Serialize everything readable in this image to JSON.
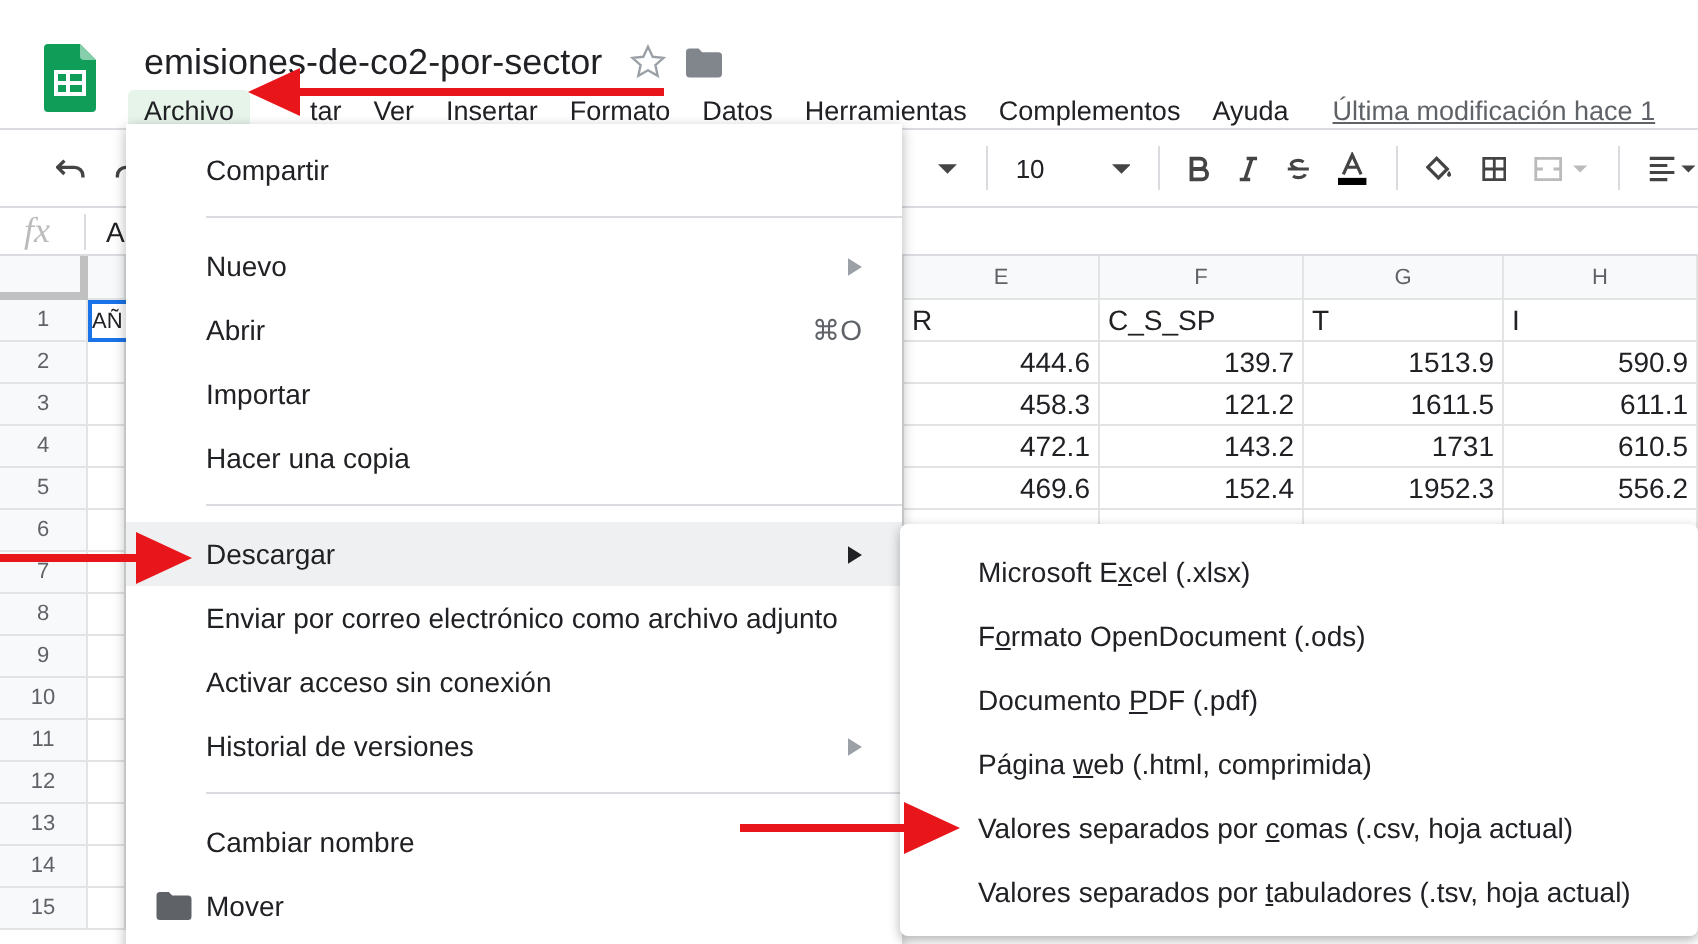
{
  "document": {
    "title": "emisiones-de-co2-por-sector",
    "starred": false
  },
  "menubar": [
    {
      "label": "Archivo",
      "selected": true
    },
    {
      "label": "tar",
      "selected": false
    },
    {
      "label": "Ver",
      "selected": false
    },
    {
      "label": "Insertar",
      "selected": false
    },
    {
      "label": "Formato",
      "selected": false
    },
    {
      "label": "Datos",
      "selected": false
    },
    {
      "label": "Herramientas",
      "selected": false
    },
    {
      "label": "Complementos",
      "selected": false
    },
    {
      "label": "Ayuda",
      "selected": false
    }
  ],
  "last_modified": "Última modificación hace 1",
  "toolbar": {
    "font_size": "10"
  },
  "formula_bar": {
    "label": "fx",
    "value": "A"
  },
  "sheet": {
    "columns": [
      "E",
      "F",
      "G",
      "H"
    ],
    "rows": [
      {
        "number": "1",
        "kind": "text",
        "column_a": "AÑ",
        "cells": [
          "R",
          "C_S_SP",
          "T",
          "I"
        ]
      },
      {
        "number": "2",
        "kind": "number",
        "cells": [
          "444.6",
          "139.7",
          "1513.9",
          "590.9"
        ]
      },
      {
        "number": "3",
        "kind": "number",
        "cells": [
          "458.3",
          "121.2",
          "1611.5",
          "611.1"
        ]
      },
      {
        "number": "4",
        "kind": "number",
        "cells": [
          "472.1",
          "143.2",
          "1731",
          "610.5"
        ]
      },
      {
        "number": "5",
        "kind": "number",
        "cells": [
          "469.6",
          "152.4",
          "1952.3",
          "556.2"
        ]
      },
      {
        "number": "6"
      },
      {
        "number": "7"
      },
      {
        "number": "8"
      },
      {
        "number": "9"
      },
      {
        "number": "10"
      },
      {
        "number": "11"
      },
      {
        "number": "12"
      },
      {
        "number": "13"
      },
      {
        "number": "14"
      },
      {
        "number": "15"
      }
    ]
  },
  "file_menu": [
    {
      "kind": "item",
      "label": "Compartir",
      "selected": false,
      "has_submenu": false
    },
    {
      "kind": "divider"
    },
    {
      "kind": "item",
      "label": "Nuevo",
      "selected": false,
      "has_submenu": true
    },
    {
      "kind": "item",
      "label": "Abrir",
      "selected": false,
      "has_submenu": false,
      "shortcut": "⌘O"
    },
    {
      "kind": "item",
      "label": "Importar",
      "selected": false,
      "has_submenu": false
    },
    {
      "kind": "item",
      "label": "Hacer una copia",
      "selected": false,
      "has_submenu": false
    },
    {
      "kind": "divider"
    },
    {
      "kind": "item",
      "label": "Descargar",
      "selected": true,
      "has_submenu": true
    },
    {
      "kind": "item",
      "label": "Enviar por correo electrónico como archivo adjunto",
      "selected": false,
      "has_submenu": false
    },
    {
      "kind": "item",
      "label": "Activar acceso sin conexión",
      "selected": false,
      "has_submenu": false
    },
    {
      "kind": "item",
      "label": "Historial de versiones",
      "selected": false,
      "has_submenu": true
    },
    {
      "kind": "divider"
    },
    {
      "kind": "item",
      "label": "Cambiar nombre",
      "selected": false,
      "has_submenu": false
    },
    {
      "kind": "folder_item",
      "label": "Mover",
      "selected": false,
      "has_submenu": false
    }
  ],
  "download_submenu": [
    {
      "before": "Microsoft E",
      "mnemonic": "x",
      "after": "cel (.xlsx)"
    },
    {
      "before": "F",
      "mnemonic": "o",
      "after": "rmato OpenDocument (.ods)"
    },
    {
      "before": "Documento ",
      "mnemonic": "P",
      "after": "DF (.pdf)"
    },
    {
      "before": "Página ",
      "mnemonic": "w",
      "after": "eb (.html, comprimida)"
    },
    {
      "before": "Valores separados por ",
      "mnemonic": "c",
      "after": "omas (.csv, hoja actual)"
    },
    {
      "before": "Valores separados por ",
      "mnemonic": "t",
      "after": "abuladores (.tsv, hoja actual)"
    }
  ]
}
